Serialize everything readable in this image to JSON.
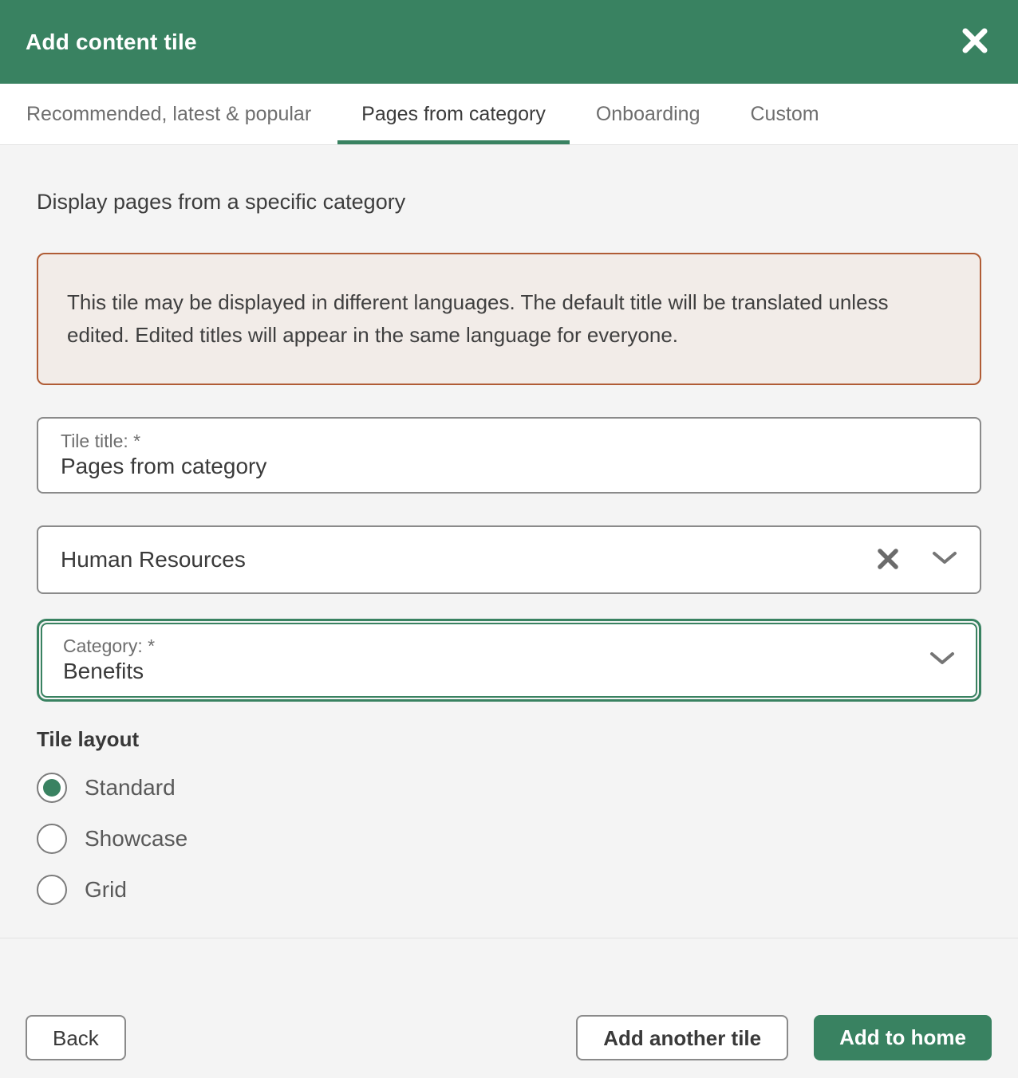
{
  "header": {
    "title": "Add content tile"
  },
  "tabs": [
    {
      "label": "Recommended, latest & popular",
      "active": false
    },
    {
      "label": "Pages from category",
      "active": true
    },
    {
      "label": "Onboarding",
      "active": false
    },
    {
      "label": "Custom",
      "active": false
    }
  ],
  "content": {
    "heading": "Display pages from a specific category",
    "notice": {
      "text": "This tile may be displayed in different languages. The default title will be translated unless edited. Edited titles will appear in the same language for everyone."
    },
    "tile_title_field": {
      "label": "Tile title: *",
      "value": "Pages from category"
    },
    "department_select": {
      "value": "Human Resources"
    },
    "category_select": {
      "label": "Category: *",
      "value": "Benefits",
      "focused": true
    },
    "tile_layout": {
      "heading": "Tile layout",
      "options": [
        {
          "label": "Standard",
          "selected": true
        },
        {
          "label": "Showcase",
          "selected": false
        },
        {
          "label": "Grid",
          "selected": false
        }
      ]
    }
  },
  "footer": {
    "back_label": "Back",
    "add_another_label": "Add another tile",
    "add_to_home_label": "Add to home"
  },
  "colors": {
    "accent_green": "#398261",
    "notice_border": "#b05c35",
    "notice_background": "#f2ece8",
    "content_background": "#f4f4f4"
  }
}
